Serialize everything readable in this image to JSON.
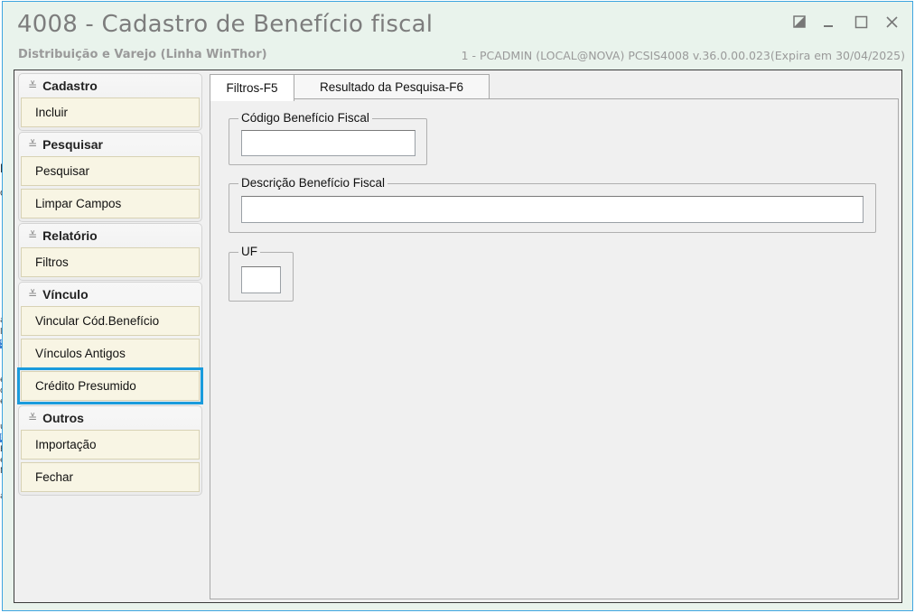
{
  "window": {
    "title": "4008 - Cadastro de Benefício fiscal",
    "subtitle_left": "Distribuição e Varejo (Linha WinThor)",
    "subtitle_right": "1 - PCADMIN (LOCAL@NOVA)   PCSIS4008  v.36.0.00.023(Expira em 30/04/2025)",
    "controls": [
      "restore-icon",
      "minimize-icon",
      "maximize-icon",
      "close-icon"
    ]
  },
  "sidebar": {
    "groups": [
      {
        "title": "Cadastro",
        "items": [
          "Incluir"
        ]
      },
      {
        "title": "Pesquisar",
        "items": [
          "Pesquisar",
          "Limpar Campos"
        ]
      },
      {
        "title": "Relatório",
        "items": [
          "Filtros"
        ]
      },
      {
        "title": "Vínculo",
        "items": [
          "Vincular Cód.Benefício",
          "Vínculos Antigos",
          "Crédito Presumido"
        ]
      },
      {
        "title": "Outros",
        "items": [
          "Importação",
          "Fechar"
        ]
      }
    ],
    "highlighted_item": "Crédito Presumido"
  },
  "tabs": [
    {
      "label": "Filtros-F5",
      "active": true
    },
    {
      "label": "Resultado da Pesquisa-F6",
      "active": false
    }
  ],
  "filters": {
    "codigo": {
      "label": "Código Benefício Fiscal",
      "value": ""
    },
    "descricao": {
      "label": "Descrição Benefício Fiscal",
      "value": ""
    },
    "uf": {
      "label": "UF",
      "value": ""
    }
  },
  "colors": {
    "accent": "#1a9bdc",
    "window_bg": "#e9f3ec",
    "button_bg": "#f8f5e4"
  }
}
